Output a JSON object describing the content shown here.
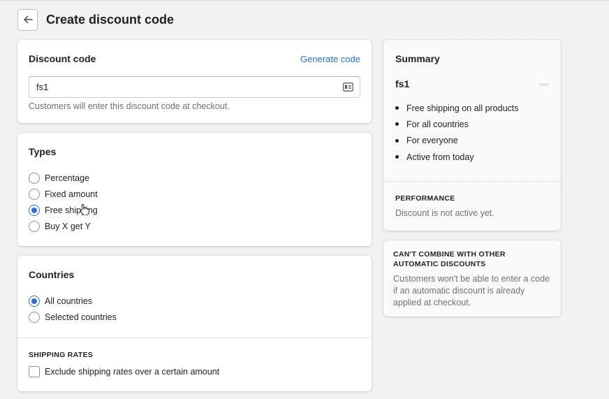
{
  "header": {
    "title": "Create discount code",
    "back_icon": "arrow-left-icon"
  },
  "discount_code": {
    "title": "Discount code",
    "generate_label": "Generate code",
    "value": "fs1",
    "help": "Customers will enter this discount code at checkout.",
    "input_icon": "id-card-icon"
  },
  "types": {
    "title": "Types",
    "options": [
      {
        "label": "Percentage",
        "checked": false
      },
      {
        "label": "Fixed amount",
        "checked": false
      },
      {
        "label": "Free shipping",
        "checked": true
      },
      {
        "label": "Buy X get Y",
        "checked": false
      }
    ]
  },
  "countries": {
    "title": "Countries",
    "options": [
      {
        "label": "All countries",
        "checked": true
      },
      {
        "label": "Selected countries",
        "checked": false
      }
    ],
    "shipping_rates_label": "SHIPPING RATES",
    "exclude_label": "Exclude shipping rates over a certain amount"
  },
  "summary": {
    "title": "Summary",
    "code": "fs1",
    "items": [
      "Free shipping on all products",
      "For all countries",
      "For everyone",
      "Active from today"
    ],
    "performance_label": "PERFORMANCE",
    "performance_text": "Discount is not active yet."
  },
  "combine": {
    "heading": "CAN'T COMBINE WITH OTHER AUTOMATIC DISCOUNTS",
    "text": "Customers won't be able to enter a code if an automatic discount is already applied at checkout."
  },
  "colors": {
    "accent": "#2c6ecb",
    "page_bg": "#f1f2f3",
    "text": "#202223",
    "muted": "#6d7175"
  }
}
